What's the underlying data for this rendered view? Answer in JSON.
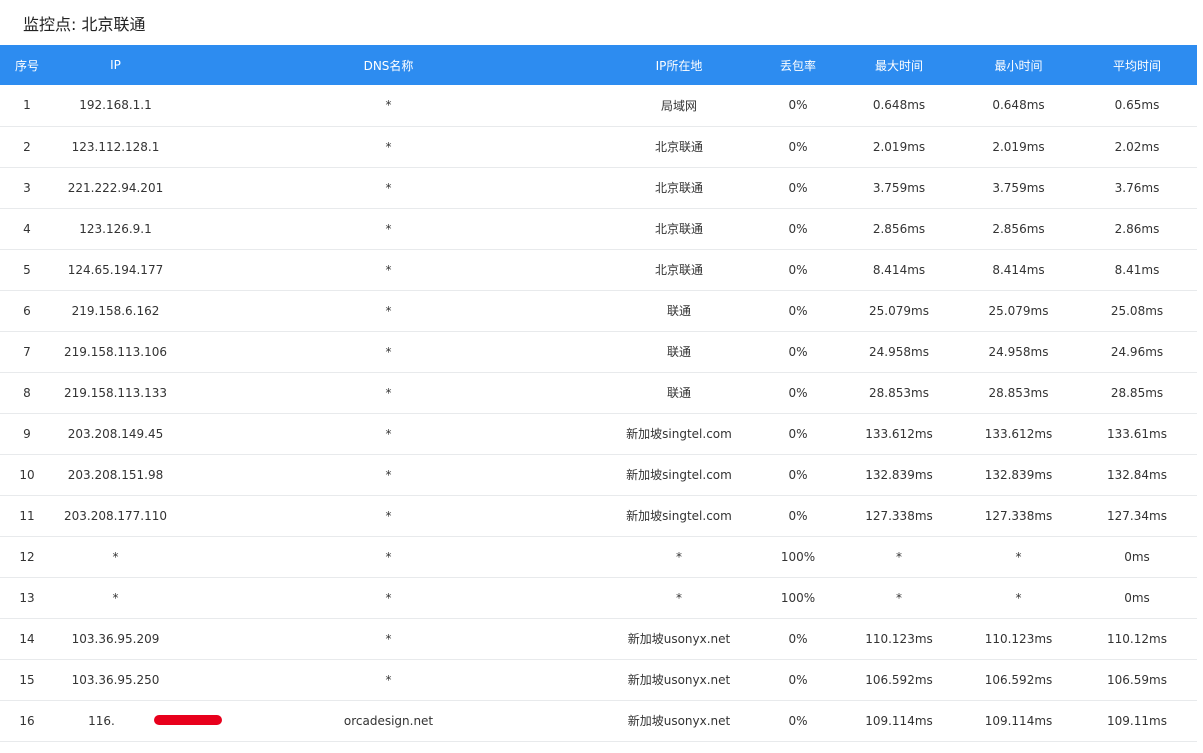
{
  "header": {
    "title": "监控点: 北京联通"
  },
  "table": {
    "columns": [
      "序号",
      "IP",
      "DNS名称",
      "IP所在地",
      "丢包率",
      "最大时间",
      "最小时间",
      "平均时间"
    ],
    "rows": [
      {
        "no": "1",
        "ip": "192.168.1.1",
        "dns": "*",
        "loc": "局域网",
        "loss": "0%",
        "max": "0.648ms",
        "min": "0.648ms",
        "avg": "0.65ms"
      },
      {
        "no": "2",
        "ip": "123.112.128.1",
        "dns": "*",
        "loc": "北京联通",
        "loss": "0%",
        "max": "2.019ms",
        "min": "2.019ms",
        "avg": "2.02ms"
      },
      {
        "no": "3",
        "ip": "221.222.94.201",
        "dns": "*",
        "loc": "北京联通",
        "loss": "0%",
        "max": "3.759ms",
        "min": "3.759ms",
        "avg": "3.76ms"
      },
      {
        "no": "4",
        "ip": "123.126.9.1",
        "dns": "*",
        "loc": "北京联通",
        "loss": "0%",
        "max": "2.856ms",
        "min": "2.856ms",
        "avg": "2.86ms"
      },
      {
        "no": "5",
        "ip": "124.65.194.177",
        "dns": "*",
        "loc": "北京联通",
        "loss": "0%",
        "max": "8.414ms",
        "min": "8.414ms",
        "avg": "8.41ms"
      },
      {
        "no": "6",
        "ip": "219.158.6.162",
        "dns": "*",
        "loc": "联通",
        "loss": "0%",
        "max": "25.079ms",
        "min": "25.079ms",
        "avg": "25.08ms"
      },
      {
        "no": "7",
        "ip": "219.158.113.106",
        "dns": "*",
        "loc": "联通",
        "loss": "0%",
        "max": "24.958ms",
        "min": "24.958ms",
        "avg": "24.96ms"
      },
      {
        "no": "8",
        "ip": "219.158.113.133",
        "dns": "*",
        "loc": "联通",
        "loss": "0%",
        "max": "28.853ms",
        "min": "28.853ms",
        "avg": "28.85ms"
      },
      {
        "no": "9",
        "ip": "203.208.149.45",
        "dns": "*",
        "loc": "新加坡singtel.com",
        "loss": "0%",
        "max": "133.612ms",
        "min": "133.612ms",
        "avg": "133.61ms"
      },
      {
        "no": "10",
        "ip": "203.208.151.98",
        "dns": "*",
        "loc": "新加坡singtel.com",
        "loss": "0%",
        "max": "132.839ms",
        "min": "132.839ms",
        "avg": "132.84ms"
      },
      {
        "no": "11",
        "ip": "203.208.177.110",
        "dns": "*",
        "loc": "新加坡singtel.com",
        "loss": "0%",
        "max": "127.338ms",
        "min": "127.338ms",
        "avg": "127.34ms"
      },
      {
        "no": "12",
        "ip": "*",
        "dns": "*",
        "loc": "*",
        "loss": "100%",
        "max": "*",
        "min": "*",
        "avg": "0ms"
      },
      {
        "no": "13",
        "ip": "*",
        "dns": "*",
        "loc": "*",
        "loss": "100%",
        "max": "*",
        "min": "*",
        "avg": "0ms"
      },
      {
        "no": "14",
        "ip": "103.36.95.209",
        "dns": "*",
        "loc": "新加坡usonyx.net",
        "loss": "0%",
        "max": "110.123ms",
        "min": "110.123ms",
        "avg": "110.12ms"
      },
      {
        "no": "15",
        "ip": "103.36.95.250",
        "dns": "*",
        "loc": "新加坡usonyx.net",
        "loss": "0%",
        "max": "106.592ms",
        "min": "106.592ms",
        "avg": "106.59ms"
      },
      {
        "no": "16",
        "ip": "116.",
        "dns": "orcadesign.net",
        "loc": "新加坡usonyx.net",
        "loss": "0%",
        "max": "109.114ms",
        "min": "109.114ms",
        "avg": "109.11ms",
        "redacted": true
      }
    ]
  },
  "colors": {
    "header_bg": "#2d8cf0",
    "redaction": "#e8001c"
  }
}
